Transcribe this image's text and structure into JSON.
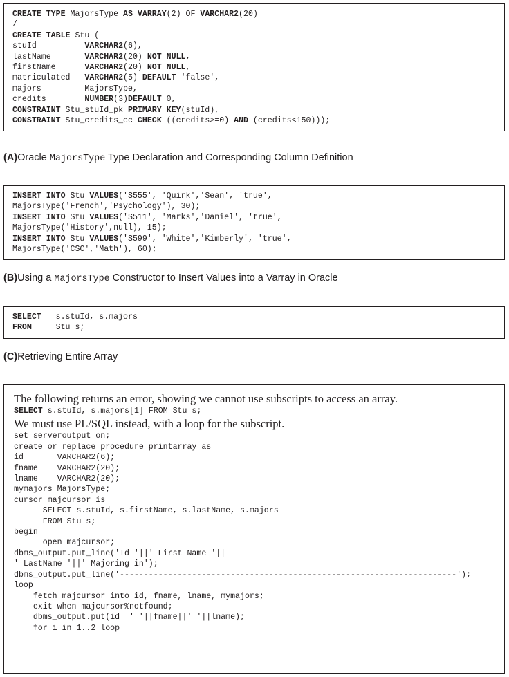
{
  "figure": {
    "panels": [
      {
        "id": "A",
        "caption_label": "(A)",
        "caption_pre": "Oracle ",
        "caption_mono": "MajorsType",
        "caption_post": " Type Declaration and Corresponding Column Definition",
        "code": [
          [
            {
              "t": "CREATE TYPE ",
              "b": true
            },
            {
              "t": "MajorsType ",
              "b": false
            },
            {
              "t": "AS VARRAY",
              "b": true
            },
            {
              "t": "(2) OF ",
              "b": false
            },
            {
              "t": "VARCHAR2",
              "b": true
            },
            {
              "t": "(20)",
              "b": false
            }
          ],
          [
            {
              "t": "/",
              "b": false
            }
          ],
          [
            {
              "t": "CREATE TABLE ",
              "b": true
            },
            {
              "t": "Stu (",
              "b": false
            }
          ],
          [
            {
              "t": "stuId          ",
              "b": false
            },
            {
              "t": "VARCHAR2",
              "b": true
            },
            {
              "t": "(6),",
              "b": false
            }
          ],
          [
            {
              "t": "lastName       ",
              "b": false
            },
            {
              "t": "VARCHAR2",
              "b": true
            },
            {
              "t": "(20) ",
              "b": false
            },
            {
              "t": "NOT NULL",
              "b": true
            },
            {
              "t": ",",
              "b": false
            }
          ],
          [
            {
              "t": "firstName      ",
              "b": false
            },
            {
              "t": "VARCHAR2",
              "b": true
            },
            {
              "t": "(20) ",
              "b": false
            },
            {
              "t": "NOT NULL",
              "b": true
            },
            {
              "t": ",",
              "b": false
            }
          ],
          [
            {
              "t": "matriculated   ",
              "b": false
            },
            {
              "t": "VARCHAR2",
              "b": true
            },
            {
              "t": "(5) ",
              "b": false
            },
            {
              "t": "DEFAULT",
              "b": true
            },
            {
              "t": " 'false',",
              "b": false
            }
          ],
          [
            {
              "t": "majors         MajorsType,",
              "b": false
            }
          ],
          [
            {
              "t": "credits        ",
              "b": false
            },
            {
              "t": "NUMBER",
              "b": true
            },
            {
              "t": "(3)",
              "b": false
            },
            {
              "t": "DEFAULT",
              "b": true
            },
            {
              "t": " 0,",
              "b": false
            }
          ],
          [
            {
              "t": "CONSTRAINT",
              "b": true
            },
            {
              "t": " Stu_stuId_pk ",
              "b": false
            },
            {
              "t": "PRIMARY KEY",
              "b": true
            },
            {
              "t": "(stuId),",
              "b": false
            }
          ],
          [
            {
              "t": "CONSTRAINT",
              "b": true
            },
            {
              "t": " Stu_credits_cc ",
              "b": false
            },
            {
              "t": "CHECK",
              "b": true
            },
            {
              "t": " ((credits>=0) ",
              "b": false
            },
            {
              "t": "AND",
              "b": true
            },
            {
              "t": " (credits<150)));",
              "b": false
            }
          ]
        ]
      },
      {
        "id": "B",
        "caption_label": "(B)",
        "caption_pre": "Using a ",
        "caption_mono": "MajorsType",
        "caption_post": " Constructor to Insert Values into a Varray in Oracle",
        "code": [
          [
            {
              "t": "INSERT INTO ",
              "b": true
            },
            {
              "t": "Stu ",
              "b": false
            },
            {
              "t": "VALUES",
              "b": true
            },
            {
              "t": "('S555', 'Quirk','Sean', 'true',",
              "b": false
            }
          ],
          [
            {
              "t": "MajorsType('French','Psychology'), 30);",
              "b": false
            }
          ],
          [
            {
              "t": "INSERT INTO ",
              "b": true
            },
            {
              "t": "Stu ",
              "b": false
            },
            {
              "t": "VALUES",
              "b": true
            },
            {
              "t": "('S511', 'Marks','Daniel', 'true',",
              "b": false
            }
          ],
          [
            {
              "t": "MajorsType('History',null), 15);",
              "b": false
            }
          ],
          [
            {
              "t": "INSERT INTO ",
              "b": true
            },
            {
              "t": "Stu ",
              "b": false
            },
            {
              "t": "VALUES",
              "b": true
            },
            {
              "t": "('S599', 'White','Kimberly', 'true',",
              "b": false
            }
          ],
          [
            {
              "t": "MajorsType('CSC','Math'), 60);",
              "b": false
            }
          ]
        ]
      },
      {
        "id": "C",
        "caption_label": "(C)",
        "caption_pre": "Retrieving Entire Array",
        "caption_mono": "",
        "caption_post": "",
        "code": [
          [
            {
              "t": "SELECT",
              "b": true
            },
            {
              "t": "   s.stuId, s.majors",
              "b": false
            }
          ],
          [
            {
              "t": "FROM",
              "b": true
            },
            {
              "t": "     Stu s;",
              "b": false
            }
          ]
        ]
      },
      {
        "id": "D",
        "caption_label": "",
        "caption_pre": "",
        "caption_mono": "",
        "caption_post": "",
        "lines": [
          {
            "kind": "prose",
            "text": "The following returns an error, showing we cannot use subscripts to access an array."
          },
          {
            "kind": "code",
            "runs": [
              {
                "t": "SELECT",
                "b": true
              },
              {
                "t": " s.stuId, s.majors[1] FROM Stu s;",
                "b": false
              }
            ]
          },
          {
            "kind": "prose",
            "text": "We must use PL/SQL instead, with a loop for the subscript."
          },
          {
            "kind": "code",
            "runs": [
              {
                "t": "set serveroutput on;",
                "b": false
              }
            ]
          },
          {
            "kind": "code",
            "runs": [
              {
                "t": "create or replace procedure printarray as",
                "b": false
              }
            ]
          },
          {
            "kind": "code",
            "runs": [
              {
                "t": "id       VARCHAR2(6);",
                "b": false
              }
            ]
          },
          {
            "kind": "code",
            "runs": [
              {
                "t": "fname    VARCHAR2(20);",
                "b": false
              }
            ]
          },
          {
            "kind": "code",
            "runs": [
              {
                "t": "lname    VARCHAR2(20);",
                "b": false
              }
            ]
          },
          {
            "kind": "code",
            "runs": [
              {
                "t": "mymajors MajorsType;",
                "b": false
              }
            ]
          },
          {
            "kind": "code",
            "runs": [
              {
                "t": "cursor majcursor is",
                "b": false
              }
            ]
          },
          {
            "kind": "code",
            "runs": [
              {
                "t": "      SELECT s.stuId, s.firstName, s.lastName, s.majors",
                "b": false
              }
            ]
          },
          {
            "kind": "code",
            "runs": [
              {
                "t": "      FROM Stu s;",
                "b": false
              }
            ]
          },
          {
            "kind": "code",
            "runs": [
              {
                "t": "begin",
                "b": false
              }
            ]
          },
          {
            "kind": "code",
            "runs": [
              {
                "t": "      open majcursor;",
                "b": false
              }
            ]
          },
          {
            "kind": "code",
            "runs": [
              {
                "t": "dbms_output.put_line('Id '||' First Name '||",
                "b": false
              }
            ]
          },
          {
            "kind": "code",
            "runs": [
              {
                "t": "' LastName '||' Majoring in');",
                "b": false
              }
            ]
          },
          {
            "kind": "code",
            "runs": [
              {
                "t": "dbms_output.put_line('----------------------------------------------------------------------');",
                "b": false
              }
            ]
          },
          {
            "kind": "code",
            "runs": [
              {
                "t": "loop",
                "b": false
              }
            ]
          },
          {
            "kind": "code",
            "runs": [
              {
                "t": "    fetch majcursor into id, fname, lname, mymajors;",
                "b": false
              }
            ]
          },
          {
            "kind": "code",
            "runs": [
              {
                "t": "    exit when majcursor%notfound;",
                "b": false
              }
            ]
          },
          {
            "kind": "code",
            "runs": [
              {
                "t": "    dbms_output.put(id||' '||fname||' '||lname);",
                "b": false
              }
            ]
          },
          {
            "kind": "code",
            "runs": [
              {
                "t": "    for i in 1..2 loop",
                "b": false
              }
            ]
          }
        ]
      }
    ]
  },
  "colors": {
    "ink": "#231f20",
    "border": "#231f20",
    "background": "#ffffff"
  }
}
